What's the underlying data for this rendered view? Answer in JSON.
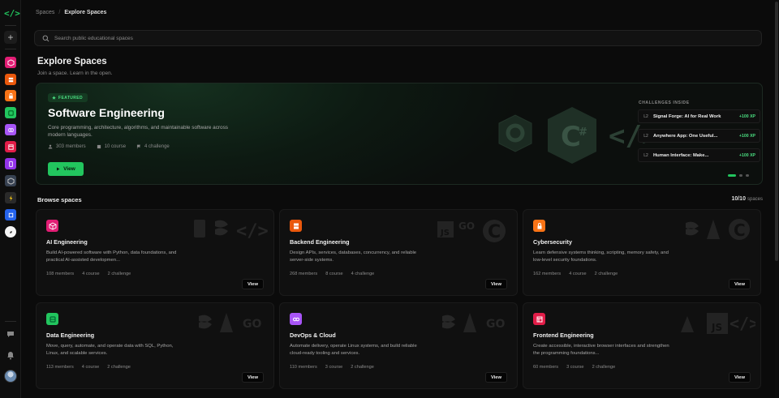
{
  "breadcrumb": {
    "root": "Spaces",
    "current": "Explore Spaces"
  },
  "search": {
    "placeholder": "Search public educational spaces"
  },
  "page": {
    "title": "Explore Spaces",
    "subtitle": "Join a space. Learn in the open."
  },
  "featured": {
    "badge": "FEATURED",
    "title": "Software Engineering",
    "description": "Core programming, architecture, algorithms, and maintainable software across modern languages.",
    "members": "303 members",
    "courses": "10 course",
    "challenges": "4 challenge",
    "view_label": "View",
    "challenges_label": "CHALLENGES INSIDE",
    "challenge_items": [
      {
        "level": "L2",
        "name": "Signal Forge: AI for Real Work",
        "xp": "+100 XP"
      },
      {
        "level": "L2",
        "name": "Anywhere App: One Useful...",
        "xp": "+100 XP"
      },
      {
        "level": "L2",
        "name": "Human Interface: Make...",
        "xp": "+100 XP"
      }
    ],
    "accent": "#22c55e"
  },
  "browse": {
    "title": "Browse spaces",
    "count": "10/10",
    "count_label": "spaces",
    "cards": [
      {
        "title": "AI Engineering",
        "description": "Build AI-powered software with Python, data foundations, and practical AI-assisted developmen...",
        "members": "108 members",
        "courses": "4 course",
        "challenges": "2 challenge",
        "view": "View",
        "color": "#e11d74",
        "icon": "cube-icon"
      },
      {
        "title": "Backend Engineering",
        "description": "Design APIs, services, databases, concurrency, and reliable server-side systems.",
        "members": "268 members",
        "courses": "8 course",
        "challenges": "4 challenge",
        "view": "View",
        "color": "#ea580c",
        "icon": "server-icon"
      },
      {
        "title": "Cybersecurity",
        "description": "Learn defensive systems thinking, scripting, memory safety, and low-level security foundations.",
        "members": "162 members",
        "courses": "4 course",
        "challenges": "2 challenge",
        "view": "View",
        "color": "#f97316",
        "icon": "lock-icon"
      },
      {
        "title": "Data Engineering",
        "description": "Move, query, automate, and operate data with SQL, Python, Linux, and scalable services.",
        "members": "113 members",
        "courses": "4 course",
        "challenges": "2 challenge",
        "view": "View",
        "color": "#22c55e",
        "icon": "database-icon"
      },
      {
        "title": "DevOps & Cloud",
        "description": "Automate delivery, operate Linux systems, and build reliable cloud-ready tooling and services.",
        "members": "110 members",
        "courses": "3 course",
        "challenges": "2 challenge",
        "view": "View",
        "color": "#a855f7",
        "icon": "infinity-icon"
      },
      {
        "title": "Frontend Engineering",
        "description": "Create accessible, interactive browser interfaces and strengthen the programming foundations...",
        "members": "60 members",
        "courses": "3 course",
        "challenges": "2 challenge",
        "view": "View",
        "color": "#e11d48",
        "icon": "layout-icon"
      }
    ]
  }
}
